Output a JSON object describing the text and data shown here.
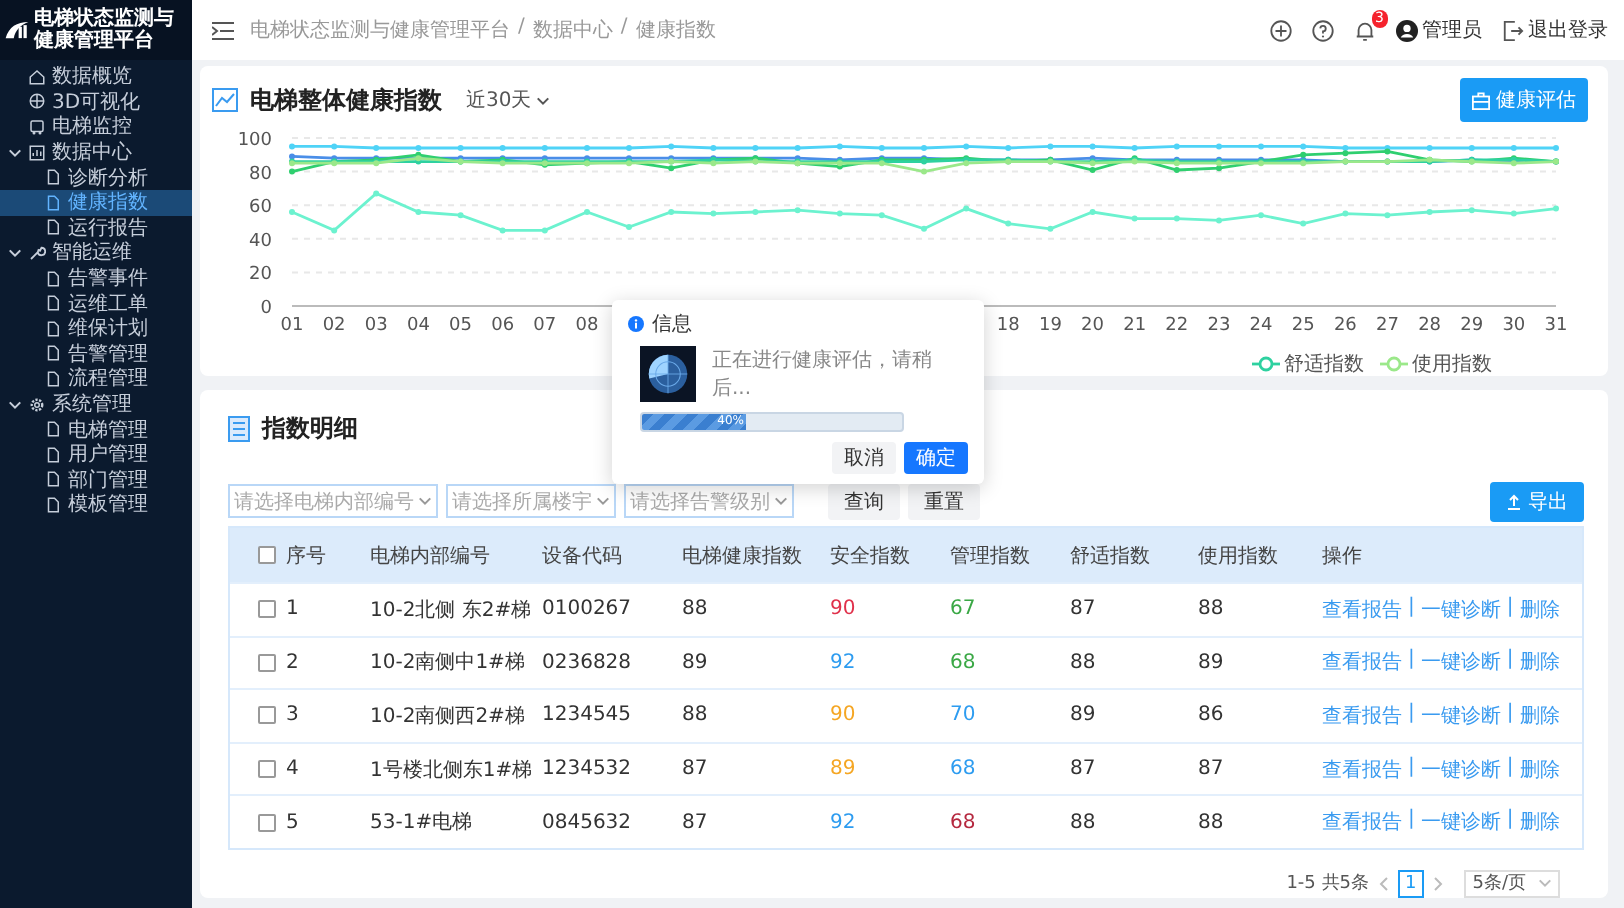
{
  "sidebar": {
    "title": "电梯状态监测与健康管理平台",
    "items": [
      {
        "label": "数据概览",
        "selected": false
      },
      {
        "label": "3D可视化",
        "selected": false
      },
      {
        "label": "电梯监控",
        "selected": false
      },
      {
        "label": "数据中心",
        "selected": false,
        "expanded": true,
        "children": [
          {
            "label": "诊断分析",
            "selected": false
          },
          {
            "label": "健康指数",
            "selected": true
          },
          {
            "label": "运行报告",
            "selected": false
          }
        ]
      },
      {
        "label": "智能运维",
        "selected": false,
        "expanded": true,
        "children": [
          {
            "label": "告警事件",
            "selected": false
          },
          {
            "label": "运维工单",
            "selected": false
          },
          {
            "label": "维保计划",
            "selected": false
          },
          {
            "label": "告警管理",
            "selected": false
          },
          {
            "label": "流程管理",
            "selected": false
          }
        ]
      },
      {
        "label": "系统管理",
        "selected": false,
        "expanded": true,
        "children": [
          {
            "label": "电梯管理",
            "selected": false
          },
          {
            "label": "用户管理",
            "selected": false
          },
          {
            "label": "部门管理",
            "selected": false
          },
          {
            "label": "模板管理",
            "selected": false
          }
        ]
      }
    ]
  },
  "header": {
    "breadcrumb": [
      "电梯状态监测与健康管理平台",
      "数据中心",
      "健康指数"
    ],
    "separator": "/",
    "notification_count": "3",
    "user": "管理员",
    "logout": "退出登录"
  },
  "health_card": {
    "title": "电梯整体健康指数",
    "range": "近30天",
    "action": "健康评估",
    "chart_data": {
      "type": "line",
      "x": [
        1,
        2,
        3,
        4,
        5,
        6,
        7,
        8,
        9,
        10,
        11,
        12,
        13,
        14,
        15,
        16,
        17,
        18,
        19,
        20,
        21,
        22,
        23,
        24,
        25,
        26,
        27,
        28,
        29,
        30,
        31
      ],
      "xticks": [
        {
          "value": 1,
          "label": "01"
        },
        {
          "value": 2,
          "label": "02"
        },
        {
          "value": 3,
          "label": "03"
        },
        {
          "value": 4,
          "label": "04"
        },
        {
          "value": 5,
          "label": "05"
        },
        {
          "value": 6,
          "label": "06"
        },
        {
          "value": 7,
          "label": "07"
        },
        {
          "value": 8,
          "label": "08"
        },
        {
          "value": 18,
          "label": "18"
        },
        {
          "value": 19,
          "label": "19"
        },
        {
          "value": 20,
          "label": "20"
        },
        {
          "value": 21,
          "label": "21"
        },
        {
          "value": 22,
          "label": "22"
        },
        {
          "value": 23,
          "label": "23"
        },
        {
          "value": 24,
          "label": "24"
        },
        {
          "value": 25,
          "label": "25"
        },
        {
          "value": 26,
          "label": "26"
        },
        {
          "value": 27,
          "label": "27"
        },
        {
          "value": 28,
          "label": "28"
        },
        {
          "value": 29,
          "label": "29"
        },
        {
          "value": 30,
          "label": "30"
        },
        {
          "value": 31,
          "label": "31"
        }
      ],
      "xlim": [
        1,
        31
      ],
      "ylim": [
        0,
        100
      ],
      "yticks": [
        0,
        20,
        40,
        60,
        80,
        100
      ],
      "grid": true,
      "legend": "bottom",
      "series": [
        {
          "color": "#4fd3f7",
          "values": [
            95,
            95,
            94,
            94,
            94,
            94,
            94,
            94,
            94,
            95,
            94,
            94,
            94,
            95,
            94,
            94,
            95,
            94,
            95,
            95,
            94,
            95,
            95,
            95,
            95,
            94,
            94,
            94,
            94,
            94,
            94
          ]
        },
        {
          "color": "#4a8ee8",
          "values": [
            89,
            88,
            88,
            88,
            88,
            88,
            88,
            88,
            88,
            88,
            88,
            88,
            88,
            87,
            88,
            88,
            87,
            87,
            87,
            88,
            87,
            87,
            87,
            87,
            87,
            86,
            86,
            86,
            87,
            86,
            86
          ]
        },
        {
          "color": "#2fcf6f",
          "values": [
            80,
            86,
            87,
            90,
            86,
            87,
            84,
            85,
            86,
            82,
            87,
            88,
            85,
            83,
            87,
            87,
            88,
            86,
            87,
            81,
            88,
            81,
            82,
            86,
            90,
            91,
            92,
            87,
            86,
            88,
            86
          ]
        },
        {
          "name": "舒适指数",
          "color": "#2ed1a0",
          "values": [
            86,
            86,
            86,
            86,
            86,
            86,
            86,
            86,
            86,
            86,
            87,
            86,
            86,
            86,
            86,
            86,
            87,
            87,
            86,
            86,
            87,
            86,
            86,
            86,
            86,
            86,
            86,
            86,
            87,
            87,
            86
          ]
        },
        {
          "name": "使用指数",
          "color": "#9be88a",
          "values": [
            85,
            85,
            85,
            88,
            86,
            85,
            85,
            85,
            85,
            86,
            85,
            86,
            85,
            85,
            85,
            80,
            85,
            86,
            86,
            85,
            86,
            85,
            85,
            85,
            85,
            86,
            86,
            87,
            86,
            85,
            86
          ]
        },
        {
          "color": "#6cf2cf",
          "values": [
            56,
            45,
            67,
            56,
            54,
            45,
            45,
            56,
            47,
            56,
            55,
            56,
            57,
            55,
            54,
            46,
            58,
            49,
            46,
            56,
            52,
            52,
            51,
            54,
            49,
            55,
            54,
            56,
            57,
            55,
            58
          ]
        }
      ]
    }
  },
  "detail_card": {
    "title": "指数明细",
    "filters": [
      {
        "placeholder": "请选择电梯内部编号"
      },
      {
        "placeholder": "请选择所属楼宇"
      },
      {
        "placeholder": "请选择告警级别"
      }
    ],
    "buttons": [
      "查询",
      "重置"
    ],
    "export": "导出",
    "table": {
      "header_checked": false,
      "action_separator": "|",
      "columns": [
        "序号",
        "电梯内部编号",
        "设备代码",
        "电梯健康指数",
        "安全指数",
        "管理指数",
        "舒适指数",
        "使用指数",
        "操作"
      ],
      "rows": [
        {
          "checked": false,
          "no": "1",
          "code": "10-2北侧 东2#梯",
          "device": "0100267",
          "health": "88",
          "safety": {
            "text": "90",
            "color": "#e0314b"
          },
          "management": {
            "text": "67",
            "color": "#3aa845"
          },
          "comfort": "87",
          "usage": "88",
          "actions": [
            "查看报告",
            "一键诊断",
            "删除"
          ]
        },
        {
          "checked": false,
          "no": "2",
          "code": "10-2南侧中1#梯",
          "device": "0236828",
          "health": "89",
          "safety": {
            "text": "92",
            "color": "#2d9cf0"
          },
          "management": {
            "text": "68",
            "color": "#3aa845"
          },
          "comfort": "88",
          "usage": "89",
          "actions": [
            "查看报告",
            "一键诊断",
            "删除"
          ]
        },
        {
          "checked": false,
          "no": "3",
          "code": "10-2南侧西2#梯",
          "device": "1234545",
          "health": "88",
          "safety": {
            "text": "90",
            "color": "#f5a623"
          },
          "management": {
            "text": "70",
            "color": "#2d9cf0"
          },
          "comfort": "89",
          "usage": "86",
          "actions": [
            "查看报告",
            "一键诊断",
            "删除"
          ]
        },
        {
          "checked": false,
          "no": "4",
          "code": "1号楼北侧东1#梯",
          "device": "1234532",
          "health": "87",
          "safety": {
            "text": "89",
            "color": "#f5a623"
          },
          "management": {
            "text": "68",
            "color": "#2d9cf0"
          },
          "comfort": "87",
          "usage": "87",
          "actions": [
            "查看报告",
            "一键诊断",
            "删除"
          ]
        },
        {
          "checked": false,
          "no": "5",
          "code": "53-1#电梯",
          "device": "0845632",
          "health": "87",
          "safety": {
            "text": "92",
            "color": "#2d9cf0"
          },
          "management": {
            "text": "68",
            "color": "#b5283f"
          },
          "comfort": "88",
          "usage": "88",
          "actions": [
            "查看报告",
            "一键诊断",
            "删除"
          ]
        }
      ]
    },
    "pagination": {
      "summary": "1-5 共5条",
      "pages": [
        {
          "label": "1",
          "selected": true
        }
      ],
      "page_size": "5条/页"
    }
  },
  "dialog": {
    "title": "信息",
    "message": "正在进行健康评估，请稍后...",
    "progress": {
      "level": 0.4,
      "reading": "40%"
    },
    "buttons": [
      {
        "label": "取消",
        "kind": "default"
      },
      {
        "label": "确定",
        "kind": "primary"
      }
    ]
  }
}
